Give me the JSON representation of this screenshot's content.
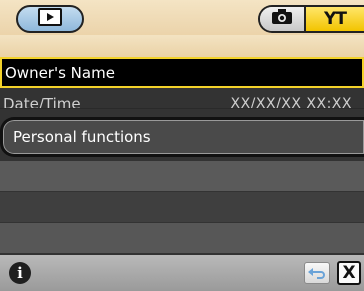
{
  "header": {
    "playback_icon": "play-icon",
    "camera_icon": "camera-icon",
    "setup_icon": "setup-wrench-icon",
    "setup_label": "YT"
  },
  "menu": {
    "items": [
      {
        "label": "Owner's Name",
        "value": ""
      },
      {
        "label": "Date/Time",
        "value": "XX/XX/XX XX:XX"
      },
      {
        "label": "Personal functions",
        "value": ""
      }
    ]
  },
  "footer": {
    "info_label": "i",
    "back_icon": "back-arrow-icon",
    "close_label": "X"
  },
  "colors": {
    "highlight_border": "#f3d22a",
    "setup_tab": "#f2c400",
    "playback_tab": "#8fb8db"
  }
}
